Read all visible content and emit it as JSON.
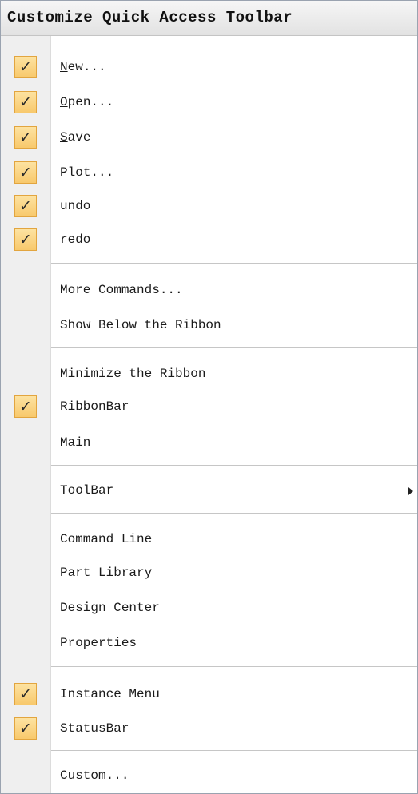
{
  "menu": {
    "title": "Customize Quick Access Toolbar",
    "check_glyph": "✓",
    "submenu_arrow_icon": "chevron-right-icon",
    "items": [
      {
        "label": "New...",
        "mnemonic": "N",
        "rest": "ew...",
        "checked": true
      },
      {
        "label": "Open...",
        "mnemonic": "O",
        "rest": "pen...",
        "checked": true
      },
      {
        "label": "Save",
        "mnemonic": "S",
        "rest": "ave",
        "checked": true
      },
      {
        "label": "Plot...",
        "mnemonic": "P",
        "rest": "lot...",
        "checked": true
      },
      {
        "label": "undo",
        "checked": true
      },
      {
        "label": "redo",
        "checked": true
      },
      {
        "label": "More Commands...",
        "checked": false
      },
      {
        "label": "Show Below the Ribbon",
        "checked": false
      },
      {
        "label": "Minimize the Ribbon",
        "checked": false
      },
      {
        "label": "RibbonBar",
        "checked": true
      },
      {
        "label": "Main",
        "checked": false
      },
      {
        "label": "ToolBar",
        "checked": false,
        "has_submenu": true
      },
      {
        "label": "Command Line",
        "checked": false
      },
      {
        "label": "Part Library",
        "checked": false
      },
      {
        "label": "Design Center",
        "checked": false
      },
      {
        "label": "Properties",
        "checked": false
      },
      {
        "label": "Instance Menu",
        "checked": true
      },
      {
        "label": "StatusBar",
        "checked": true
      },
      {
        "label": "Custom...",
        "checked": false
      }
    ]
  },
  "colors": {
    "check_fill": "#fbd68a",
    "check_border": "#e2a53f",
    "gutter": "#efefef",
    "separator": "#c6c6c6"
  }
}
